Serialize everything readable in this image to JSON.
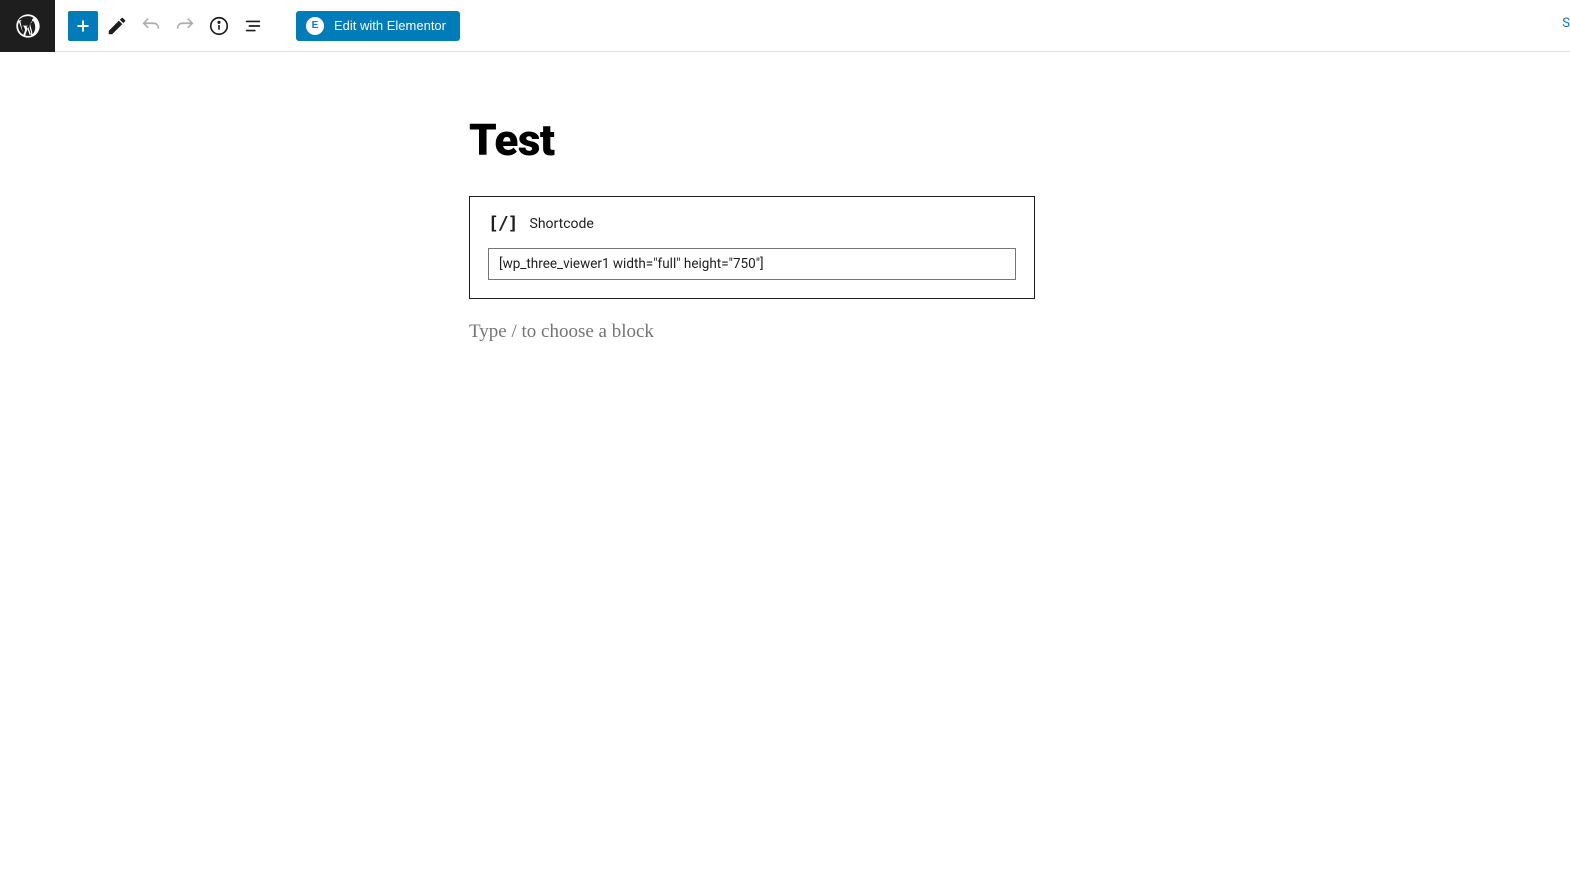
{
  "toolbar": {
    "elementor_button_label": "Edit with Elementor",
    "right_link_char": "S"
  },
  "page": {
    "title": "Test"
  },
  "shortcode_block": {
    "label": "Shortcode",
    "value": "[wp_three_viewer1 width=\"full\" height=\"750\"]"
  },
  "block_placeholder": "Type / to choose a block"
}
